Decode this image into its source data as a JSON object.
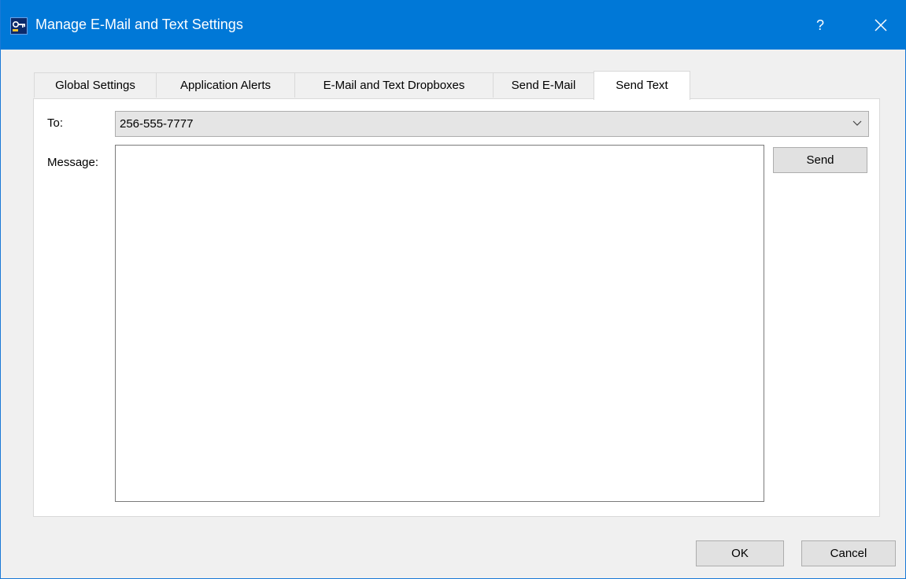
{
  "window": {
    "title": "Manage E-Mail and Text Settings",
    "help_label": "?",
    "close_icon": "close-icon",
    "app_icon": "app-key-icon"
  },
  "tabs": [
    {
      "label": "Global Settings",
      "active": false
    },
    {
      "label": "Application Alerts",
      "active": false
    },
    {
      "label": "E-Mail and Text Dropboxes",
      "active": false
    },
    {
      "label": "Send E-Mail",
      "active": false
    },
    {
      "label": "Send Text",
      "active": true
    }
  ],
  "send_text": {
    "to_label": "To:",
    "to_value": "256-555-7777",
    "message_label": "Message:",
    "message_value": "",
    "send_label": "Send"
  },
  "footer": {
    "ok_label": "OK",
    "cancel_label": "Cancel"
  },
  "colors": {
    "titlebar": "#0078d7",
    "dialog_bg": "#f0f0f0",
    "panel_bg": "#ffffff"
  }
}
